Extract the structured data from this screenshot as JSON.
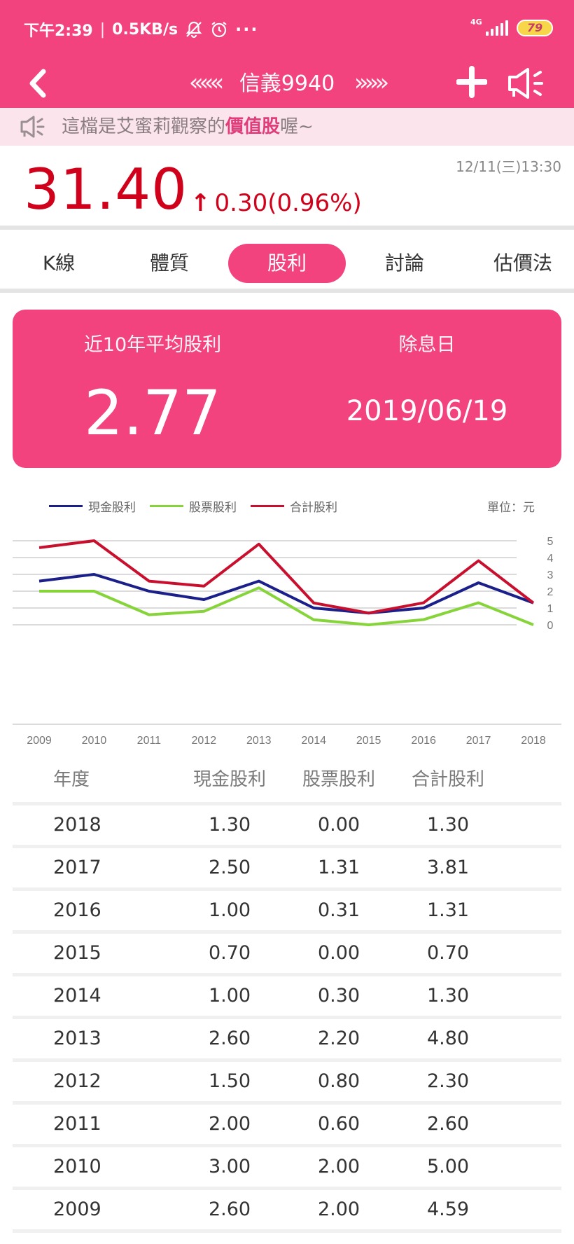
{
  "status_bar": {
    "time": "下午2:39",
    "speed": "0.5KB/s",
    "network": "4G",
    "battery": "79"
  },
  "nav": {
    "back_icon": "chevron-left-icon",
    "title": "信義9940",
    "prev_icon": "double-chevron-left-icon",
    "next_icon": "double-chevron-right-icon",
    "add_icon": "plus-icon",
    "speaker_icon": "megaphone-icon"
  },
  "notice": {
    "prefix": "這檔是艾蜜莉觀察的",
    "highlight": "價值股",
    "suffix": "喔~"
  },
  "price": {
    "datetime": "12/11(三)13:30",
    "current": "31.40",
    "arrow": "↑",
    "change": "0.30(0.96%)"
  },
  "tabs": [
    {
      "label": "K線"
    },
    {
      "label": "體質"
    },
    {
      "label": "股利"
    },
    {
      "label": "討論"
    },
    {
      "label": "估價法"
    }
  ],
  "summary": {
    "avg_label": "近10年平均股利",
    "avg_value": "2.77",
    "exdiv_label": "除息日",
    "exdiv_value": "2019/06/19"
  },
  "chart_data": {
    "type": "line",
    "title": "",
    "unit_label": "單位：元",
    "x": [
      "2009",
      "2010",
      "2011",
      "2012",
      "2013",
      "2014",
      "2015",
      "2016",
      "2017",
      "2018"
    ],
    "yticks": [
      0,
      1,
      2,
      3,
      4,
      5
    ],
    "ylim": [
      0,
      5
    ],
    "grid": true,
    "legend_position": "top-left",
    "series": [
      {
        "name": "現金股利",
        "color": "#1b1f8a",
        "values": [
          2.6,
          3.0,
          2.0,
          1.5,
          2.6,
          1.0,
          0.7,
          1.0,
          2.5,
          1.3
        ]
      },
      {
        "name": "股票股利",
        "color": "#86d43a",
        "values": [
          2.0,
          2.0,
          0.6,
          0.8,
          2.2,
          0.3,
          0.0,
          0.31,
          1.31,
          0.0
        ]
      },
      {
        "name": "合計股利",
        "color": "#c8102e",
        "values": [
          4.59,
          5.0,
          2.6,
          2.3,
          4.8,
          1.3,
          0.7,
          1.31,
          3.81,
          1.3
        ]
      }
    ]
  },
  "table": {
    "headers": [
      "年度",
      "現金股利",
      "股票股利",
      "合計股利"
    ],
    "rows": [
      [
        "2018",
        "1.30",
        "0.00",
        "1.30"
      ],
      [
        "2017",
        "2.50",
        "1.31",
        "3.81"
      ],
      [
        "2016",
        "1.00",
        "0.31",
        "1.31"
      ],
      [
        "2015",
        "0.70",
        "0.00",
        "0.70"
      ],
      [
        "2014",
        "1.00",
        "0.30",
        "1.30"
      ],
      [
        "2013",
        "2.60",
        "2.20",
        "4.80"
      ],
      [
        "2012",
        "1.50",
        "0.80",
        "2.30"
      ],
      [
        "2011",
        "2.00",
        "0.60",
        "2.60"
      ],
      [
        "2010",
        "3.00",
        "2.00",
        "5.00"
      ],
      [
        "2009",
        "2.60",
        "2.00",
        "4.59"
      ]
    ]
  },
  "colors": {
    "brand": "#f2437f",
    "price_up": "#d0021b",
    "notice_bg": "#fbe4ec"
  }
}
